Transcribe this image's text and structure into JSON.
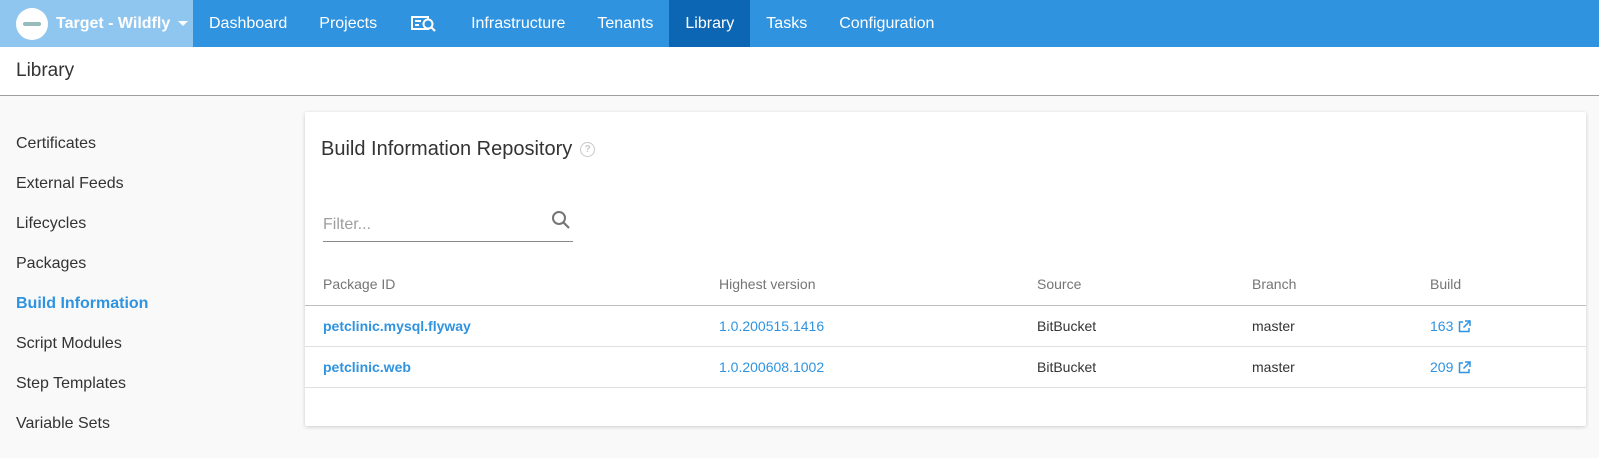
{
  "space": {
    "name": "Target - Wildfly",
    "logo_icon": "octopus-logo-icon"
  },
  "nav": {
    "items": [
      {
        "label": "Dashboard"
      },
      {
        "label": "Projects"
      },
      {
        "label": "Infrastructure"
      },
      {
        "label": "Tenants"
      },
      {
        "label": "Library",
        "active": true
      },
      {
        "label": "Tasks"
      },
      {
        "label": "Configuration"
      }
    ],
    "search_icon": "search-in-space-icon"
  },
  "page": {
    "title": "Library"
  },
  "sidebar": {
    "items": [
      {
        "label": "Certificates"
      },
      {
        "label": "External Feeds"
      },
      {
        "label": "Lifecycles"
      },
      {
        "label": "Packages"
      },
      {
        "label": "Build Information",
        "active": true
      },
      {
        "label": "Script Modules"
      },
      {
        "label": "Step Templates"
      },
      {
        "label": "Variable Sets"
      }
    ]
  },
  "card": {
    "title": "Build Information Repository",
    "help_glyph": "?",
    "filter": {
      "placeholder": "Filter...",
      "value": ""
    },
    "columns": [
      "Package ID",
      "Highest version",
      "Source",
      "Branch",
      "Build"
    ],
    "rows": [
      {
        "package_id": "petclinic.mysql.flyway",
        "version": "1.0.200515.1416",
        "source": "BitBucket",
        "branch": "master",
        "build": "163"
      },
      {
        "package_id": "petclinic.web",
        "version": "1.0.200608.1002",
        "source": "BitBucket",
        "branch": "master",
        "build": "209"
      }
    ]
  },
  "colors": {
    "primary": "#2f93e0",
    "nav_active": "#0d66b3",
    "space_bg": "#8fc6f0"
  }
}
